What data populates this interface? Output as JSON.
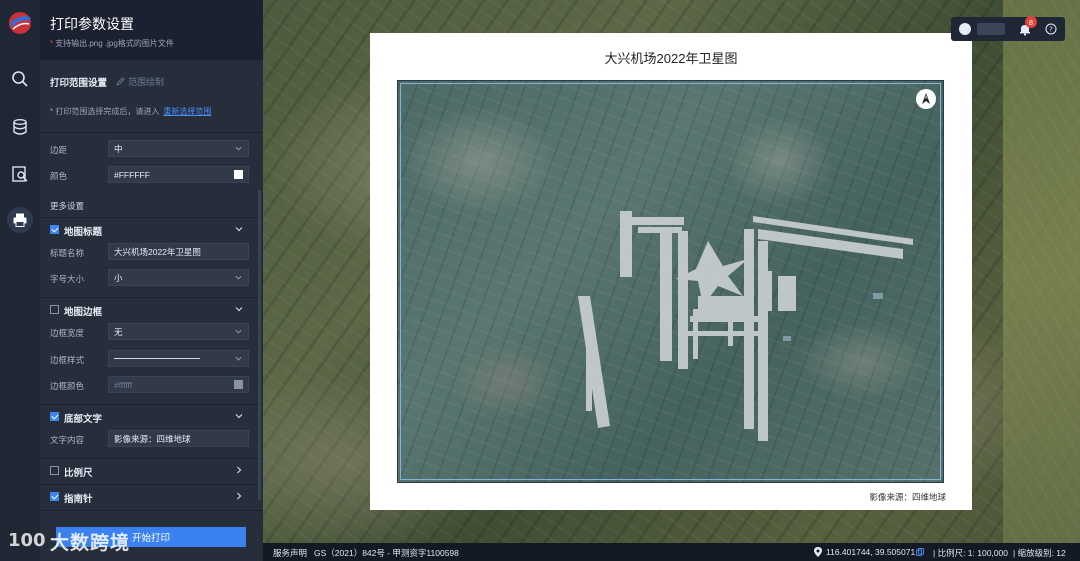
{
  "panel": {
    "title": "打印参数设置",
    "subtitle": "支持输出.png .jpg格式的图片文件",
    "range_section": "打印范围设置",
    "range_draw_link": "范围绘制",
    "range_note": "* 打印范围选择完成后，请进入",
    "range_reselect": "重新选择范围",
    "margin_label": "边距",
    "margin_value": "中",
    "color_label": "颜色",
    "color_value": "#FFFFFF",
    "more_settings": "更多设置",
    "map_title_group": "地图标题",
    "title_name_label": "标题名称",
    "title_name_value": "大兴机场2022年卫星图",
    "font_size_label": "字号大小",
    "font_size_value": "小",
    "map_border_group": "地图边框",
    "border_width_label": "边框宽度",
    "border_width_value": "无",
    "border_style_label": "边框样式",
    "border_color_label": "边框颜色",
    "border_color_placeholder": "#ffffff",
    "footer_text_group": "底部文字",
    "text_content_label": "文字内容",
    "text_content_value": "影像来源：四维地球",
    "scale_group": "比例尺",
    "compass_group": "指南针",
    "print_button": "开始打印"
  },
  "checkboxes": {
    "map_title": true,
    "map_border": false,
    "footer_text": true,
    "scale": false,
    "compass": true
  },
  "preview": {
    "title": "大兴机场2022年卫星图",
    "footer": "影像来源：四维地球",
    "north_letter": "A"
  },
  "user": {
    "notification_count": "8"
  },
  "statusbar": {
    "service": "服务声明",
    "license": "GS（2021）842号 - 甲测资字1100598",
    "coordinates": "116.401744, 39.505071",
    "scale": "| 比例尺: 1: 100,000",
    "zoom": "| 缩放级别: 12"
  },
  "watermark": {
    "text": "大数跨境"
  },
  "icons": [
    "app-logo-icon",
    "search-icon",
    "database-icon",
    "map-search-icon",
    "printer-icon",
    "chevron-down-icon",
    "chevron-right-icon",
    "pen-icon",
    "user-avatar-icon",
    "bell-icon",
    "help-icon",
    "location-pin-icon",
    "copy-icon",
    "north-arrow-icon"
  ],
  "colors": {
    "accent": "#3b82f0",
    "panel_bg": "#262d3b",
    "rail_bg": "#1f2634",
    "badge": "#e0443c"
  }
}
